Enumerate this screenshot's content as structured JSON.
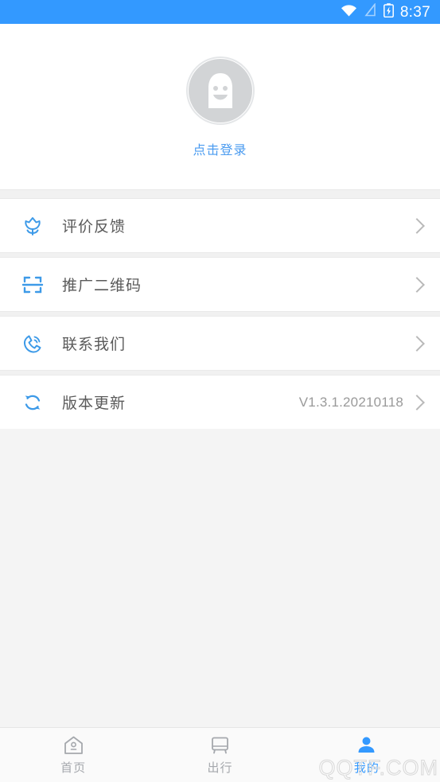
{
  "status_bar": {
    "time": "8:37",
    "icons": [
      "wifi-icon",
      "signal-off-icon",
      "battery-charging-icon"
    ],
    "background_color": "#3399ff"
  },
  "profile": {
    "avatar_icon": "default-user-avatar",
    "login_label": "点击登录",
    "login_color": "#4a9bf0"
  },
  "menu": {
    "items": [
      {
        "icon": "flower-icon",
        "label": "评价反馈",
        "value": "",
        "chevron": true
      },
      {
        "icon": "qr-scan-icon",
        "label": "推广二维码",
        "value": "",
        "chevron": true
      },
      {
        "icon": "phone-icon",
        "label": "联系我们",
        "value": "",
        "chevron": true
      },
      {
        "icon": "refresh-icon",
        "label": "版本更新",
        "value": "V1.3.1.20210118",
        "chevron": true
      }
    ],
    "icon_color": "#3d9ae8",
    "label_color": "#5a5a5a"
  },
  "tabbar": {
    "tabs": [
      {
        "icon": "home-icon",
        "label": "首页",
        "active": false
      },
      {
        "icon": "bus-icon",
        "label": "出行",
        "active": false
      },
      {
        "icon": "profile-icon",
        "label": "我的",
        "active": true
      }
    ],
    "active_color": "#3399ff",
    "inactive_color": "#a5a8ad"
  },
  "watermark": {
    "text": "QQTF.COM"
  }
}
